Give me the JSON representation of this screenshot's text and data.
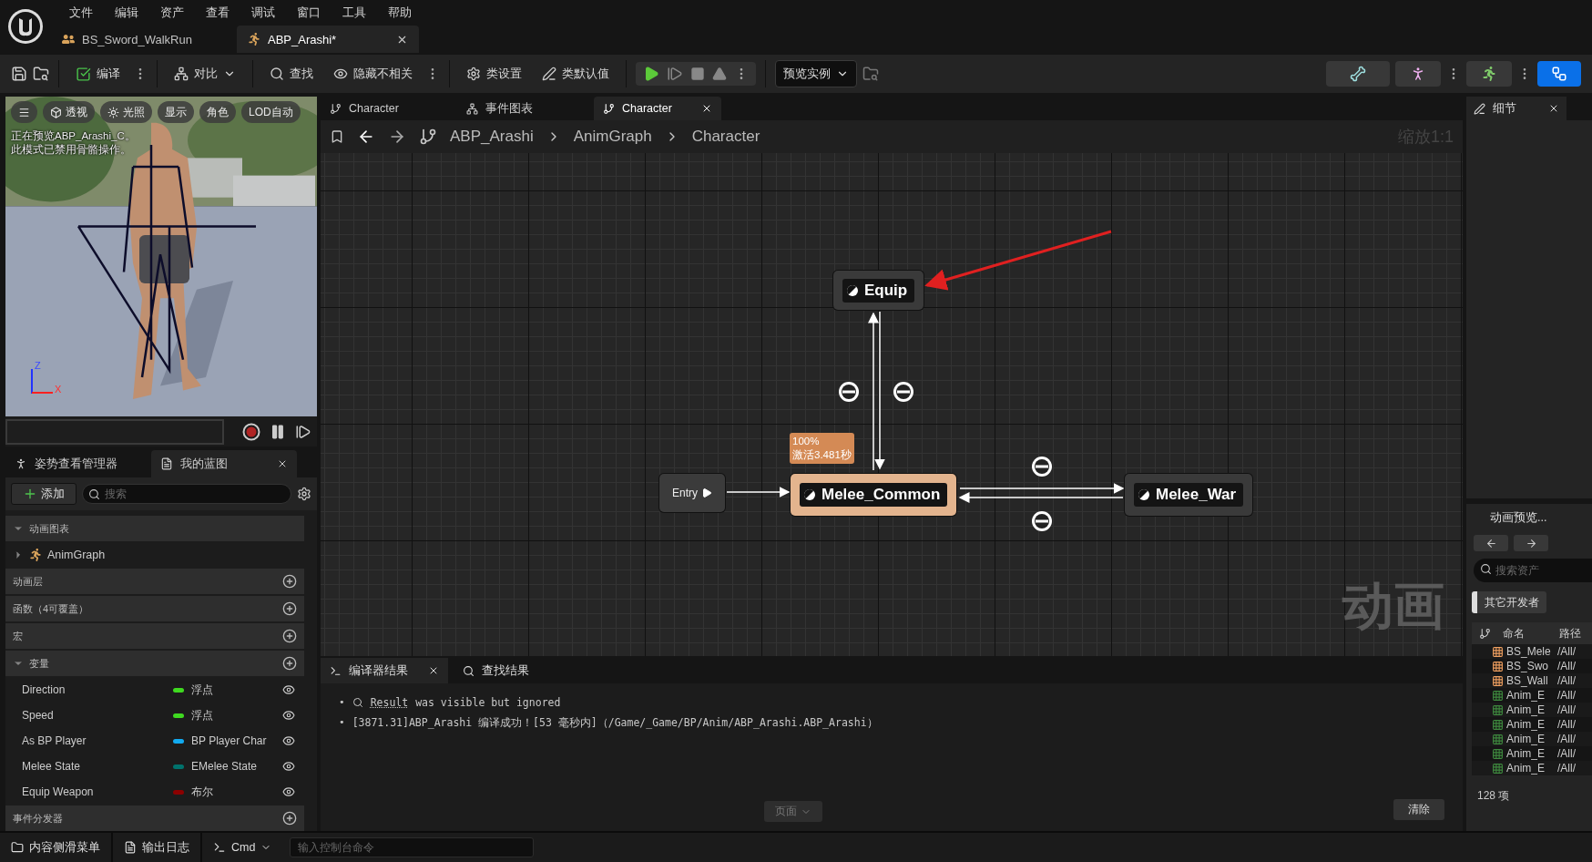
{
  "menu": [
    "文件",
    "编辑",
    "资产",
    "查看",
    "调试",
    "窗口",
    "工具",
    "帮助"
  ],
  "document_tabs": [
    {
      "label": "BS_Sword_WalkRun",
      "selected": false,
      "kind": "blendspace"
    },
    {
      "label": "ABP_Arashi*",
      "selected": true,
      "kind": "anim"
    }
  ],
  "toolbar": {
    "compile": "编译",
    "diff": "对比",
    "find": "查找",
    "hide_unrelated": "隐藏不相关",
    "class_settings": "类设置",
    "class_defaults": "类默认值",
    "preview": "预览实例"
  },
  "viewport": {
    "buttons": [
      "透视",
      "光照",
      "显示",
      "角色",
      "LOD自动"
    ],
    "message": [
      "正在预览ABP_Arashi_C。",
      "此模式已禁用骨骼操作。"
    ],
    "axes": [
      "Z",
      "X"
    ],
    "recording": false
  },
  "left_panel": {
    "tabs": [
      {
        "label": "姿势查看管理器",
        "selected": false
      },
      {
        "label": "我的蓝图",
        "selected": true
      }
    ],
    "add": "添加",
    "search": {
      "placeholder": "搜索"
    },
    "sections": [
      {
        "kind": "tree",
        "label": "动画图表",
        "expanded": true,
        "children": [
          {
            "label": "AnimGraph",
            "expanded": false
          }
        ]
      },
      {
        "kind": "section",
        "label": "动画层"
      },
      {
        "kind": "section",
        "label": "函数（4可覆盖）"
      },
      {
        "kind": "section",
        "label": "宏"
      },
      {
        "kind": "variables",
        "label": "变量",
        "expanded": true,
        "variables": [
          {
            "name": "Direction",
            "type": "浮点",
            "color": "#3fd920"
          },
          {
            "name": "Speed",
            "type": "浮点",
            "color": "#3fd920"
          },
          {
            "name": "As BP Player",
            "type": "BP Player Char",
            "color": "#12aaf0"
          },
          {
            "name": "Melee State",
            "type": "EMelee State",
            "color": "#00726c"
          },
          {
            "name": "Equip Weapon",
            "type": "布尔",
            "color": "#8c0000"
          }
        ]
      },
      {
        "kind": "section",
        "label": "事件分发器"
      }
    ]
  },
  "graph_tabs": [
    {
      "label": "Character",
      "selected": false
    },
    {
      "label": "事件图表",
      "selected": false
    },
    {
      "label": "Character",
      "selected": true
    }
  ],
  "breadcrumb": [
    "ABP_Arashi",
    "AnimGraph",
    "Character"
  ],
  "zoom": "缩放1:1",
  "graph": {
    "watermark": "动画",
    "nodes": [
      {
        "kind": "state",
        "label": "Equip",
        "active": false
      },
      {
        "kind": "entry",
        "label": "Entry"
      },
      {
        "kind": "state",
        "label": "Melee_Common",
        "active": true,
        "badge": [
          "100%",
          "激活3.481秒"
        ]
      },
      {
        "kind": "state",
        "label": "Melee_War",
        "active": false
      }
    ]
  },
  "compiler": {
    "tabs": [
      {
        "label": "编译器结果",
        "selected": true
      },
      {
        "label": "查找结果",
        "selected": false
      }
    ],
    "messages": [
      {
        "kind": "link",
        "bullet": "•",
        "link": "Result",
        "text": "was visible but ignored"
      },
      {
        "kind": "plain",
        "bullet": "•",
        "text": "[3871.31]ABP_Arashi 编译成功！[53 毫秒内]（/Game/_Game/BP/Anim/ABP_Arashi.ABP_Arashi）"
      }
    ],
    "page": "页面",
    "clear": "清除"
  },
  "details": {
    "tab": "细节"
  },
  "anim_preview": {
    "tab": "动画预览...",
    "search": {
      "placeholder": "搜索资产"
    },
    "filter": "其它开发者",
    "columns": [
      "命名",
      "路径"
    ],
    "assets": [
      {
        "kind": "blendspace",
        "name": "BS_Mele",
        "path": "/All/"
      },
      {
        "kind": "blendspace",
        "name": "BS_Swo",
        "path": "/All/"
      },
      {
        "kind": "blendspace",
        "name": "BS_Wall",
        "path": "/All/"
      },
      {
        "kind": "sequence",
        "name": "Anim_E",
        "path": "/All/"
      },
      {
        "kind": "sequence",
        "name": "Anim_E",
        "path": "/All/"
      },
      {
        "kind": "sequence",
        "name": "Anim_E",
        "path": "/All/"
      },
      {
        "kind": "sequence",
        "name": "Anim_E",
        "path": "/All/"
      },
      {
        "kind": "sequence",
        "name": "Anim_E",
        "path": "/All/"
      },
      {
        "kind": "sequence",
        "name": "Anim_E",
        "path": "/All/"
      }
    ],
    "count": "128 项"
  },
  "status_bar": {
    "content_drawer": "内容侧滑菜单",
    "output_log": "输出日志",
    "cmd": "Cmd",
    "console": {
      "placeholder": "输入控制台命令"
    }
  }
}
